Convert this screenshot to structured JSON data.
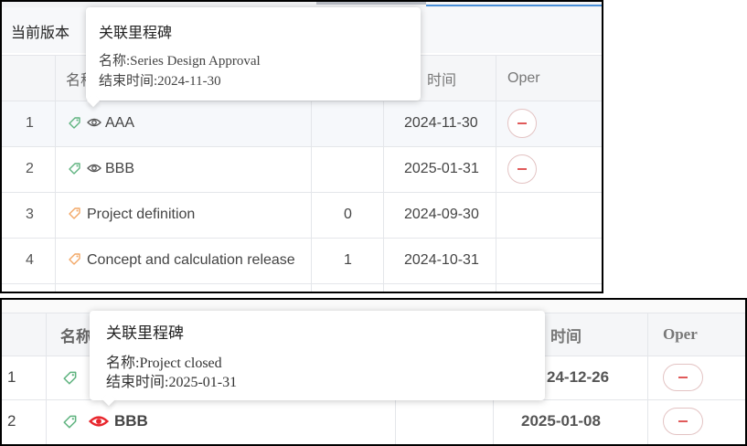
{
  "colors": {
    "header_bg": "#f5f6f8",
    "highlight_row_bg": "#f6f8fb",
    "border": "#e4e6ea",
    "tag_green": "#5fb37f",
    "tag_orange": "#f2a766",
    "eye_gray": "#555555",
    "eye_red": "#e8262d",
    "remove_red": "#e05a5a",
    "tab_accent": "#4a90d9"
  },
  "panel1": {
    "version_label": "当前版本",
    "headers": {
      "name": "名称",
      "time": "时间",
      "oper": "Oper"
    },
    "rows": [
      {
        "index": "1",
        "name": "AAA",
        "icon": "tag-icon",
        "visibility_icon": "eye-icon",
        "value": "",
        "date": "2024-11-30",
        "has_remove": true
      },
      {
        "index": "2",
        "name": "BBB",
        "icon": "tag-icon",
        "visibility_icon": "eye-icon",
        "value": "",
        "date": "2025-01-31",
        "has_remove": true
      },
      {
        "index": "3",
        "name": "Project definition",
        "icon": "tag-icon",
        "value": "0",
        "date": "2024-09-30",
        "has_remove": false
      },
      {
        "index": "4",
        "name": "Concept and calculation release",
        "icon": "tag-icon",
        "value": "1",
        "date": "2024-10-31",
        "has_remove": false
      }
    ],
    "tooltip": {
      "title": "关联里程碑",
      "name_line": "名称:Series Design Approval",
      "end_line": "结束时间:2024-11-30"
    }
  },
  "panel2": {
    "headers": {
      "name": "名称",
      "time": "时间",
      "oper": "Oper"
    },
    "rows": [
      {
        "index": "1",
        "name": "",
        "icon": "tag-icon",
        "value": "",
        "date": "24-12-26",
        "has_remove": true
      },
      {
        "index": "2",
        "name": "BBB",
        "icon": "tag-icon",
        "visibility_icon": "eye-icon",
        "value": "",
        "date": "2025-01-08",
        "has_remove": true
      }
    ],
    "tooltip": {
      "title": "关联里程碑",
      "name_line": "名称:Project closed",
      "end_line": "结束时间:2025-01-31"
    }
  }
}
